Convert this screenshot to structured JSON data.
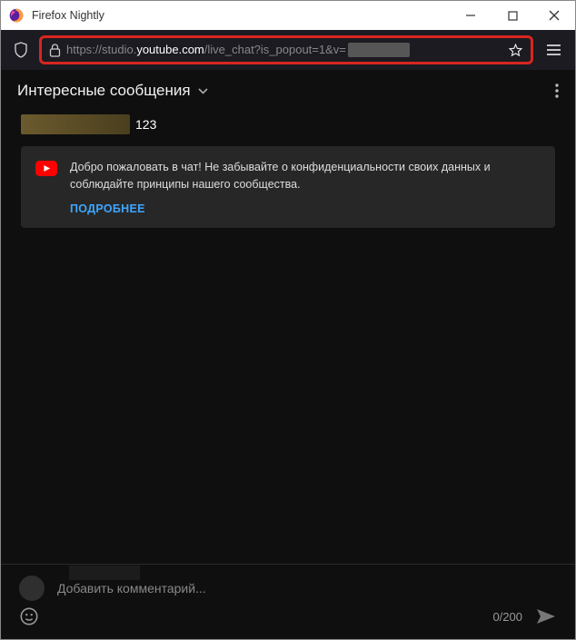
{
  "window": {
    "title": "Firefox Nightly"
  },
  "url": {
    "pre": "https://studio.",
    "domain": "youtube.com",
    "post": "/live_chat?is_popout=1&v="
  },
  "chat": {
    "header_title": "Интересные сообщения",
    "user_msg": "123"
  },
  "banner": {
    "text": "Добро пожаловать в чат! Не забывайте о конфиденциальности своих данных и соблюдайте принципы нашего сообщества.",
    "link": "ПОДРОБНЕЕ"
  },
  "footer": {
    "placeholder": "Добавить комментарий...",
    "counter": "0/200"
  }
}
